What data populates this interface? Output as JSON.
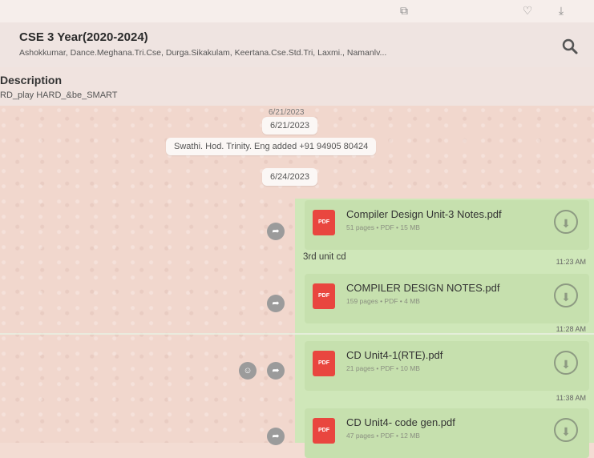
{
  "group": {
    "title": "CSE 3 Year(2020-2024)",
    "members": "Ashokkumar, Dance.Meghana.Tri.Cse, Durga.Sikakulam, Keertana.Cse.Std.Tri, Laxmi., Namanlv..."
  },
  "description": {
    "title": "Description",
    "text": "RD_play HARD_&be_SMART"
  },
  "chat": {
    "ghost_date": "6/21/2023",
    "date1": "6/21/2023",
    "system_msg": "Swathi. Hod. Trinity. Eng added +91 94905 80424",
    "date2": "6/24/2023",
    "messages": [
      {
        "name": "Compiler Design Unit-3 Notes.pdf",
        "meta": "51 pages • PDF • 15 MB",
        "caption": "3rd unit cd",
        "time": "11:23 AM"
      },
      {
        "name": "COMPILER DESIGN NOTES.pdf",
        "meta": "159 pages • PDF • 4 MB",
        "caption": "",
        "time": "11:28 AM"
      },
      {
        "name": "CD Unit4-1(RTE).pdf",
        "meta": "21 pages • PDF • 10 MB",
        "caption": "",
        "time": "11:38 AM"
      },
      {
        "name": "CD Unit4- code gen.pdf",
        "meta": "47 pages • PDF • 12 MB",
        "caption": "",
        "time": ""
      }
    ]
  },
  "icons": {
    "pdf_label": "PDF",
    "download": "download-icon",
    "forward": "forward-icon"
  }
}
